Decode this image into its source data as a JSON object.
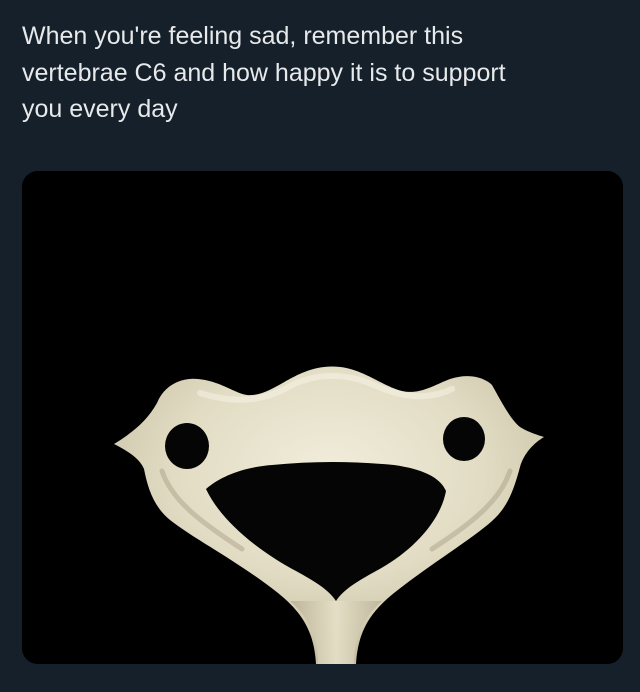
{
  "post": {
    "text": "When you're feeling sad, remember this\nvertebrae C6 and how happy it is to support\nyou every day"
  },
  "media": {
    "subject": "vertebra-bone-icon",
    "background_color": "#000000",
    "bone_color": "#e6e1cc"
  },
  "colors": {
    "page_background": "#15202b",
    "text": "#e7e9ea"
  }
}
